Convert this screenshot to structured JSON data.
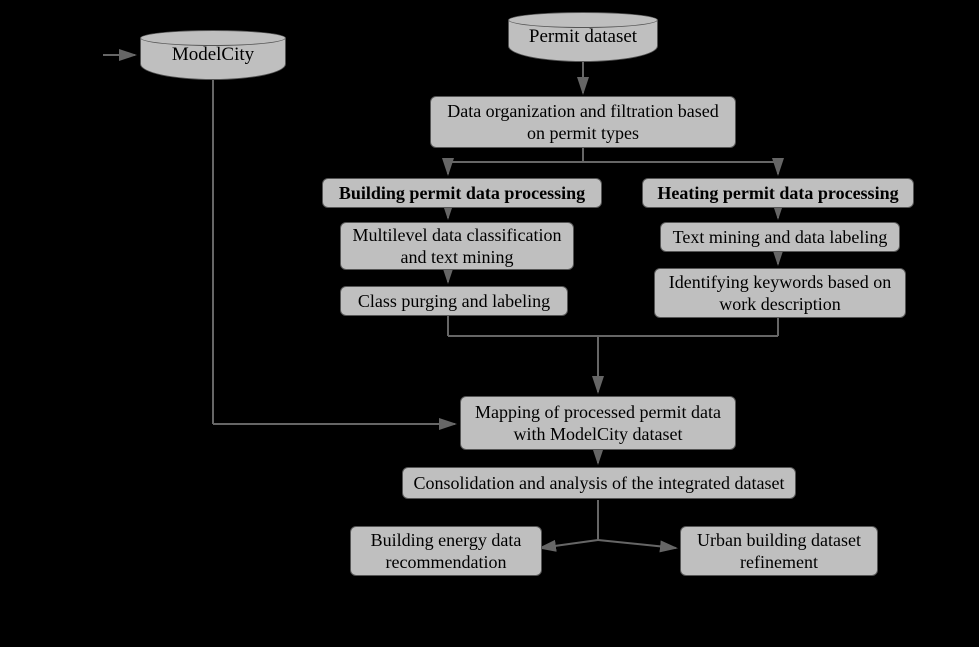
{
  "datasets": {
    "permit": "Permit dataset",
    "modelcity": "ModelCity"
  },
  "steps": {
    "organization": "Data organization and filtration based on permit types",
    "branches": {
      "building": {
        "header": "Building permit data processing",
        "s1": "Multilevel data classification and text mining",
        "s2": "Class purging and labeling"
      },
      "heating": {
        "header": "Heating permit data processing",
        "s1": "Text mining and data labeling",
        "s2": "Identifying keywords based on work description"
      }
    },
    "mapping": "Mapping of processed permit data with ModelCity dataset",
    "consolidation": "Consolidation and analysis of the integrated dataset",
    "outputs": {
      "energy": "Building energy data recommendation",
      "urban": "Urban building dataset refinement"
    }
  }
}
